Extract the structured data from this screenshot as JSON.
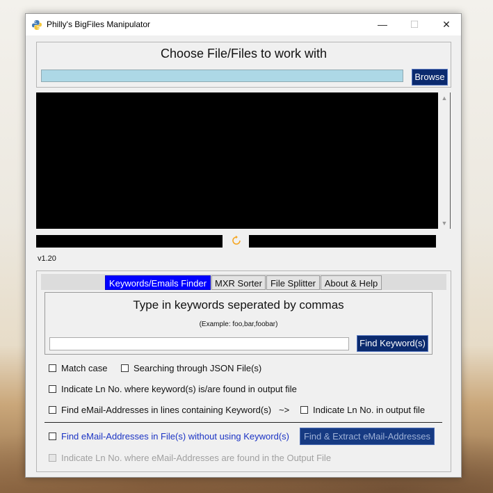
{
  "window": {
    "title": "Philly's BigFiles Manipulator",
    "controls": {
      "minimize": "—",
      "maximize": "☐",
      "close": "✕"
    }
  },
  "choose": {
    "title": "Choose File/Files to work with",
    "path_value": "",
    "browse_label": "Browse"
  },
  "version": "v1.20",
  "tabs": [
    {
      "label": "Keywords/Emails Finder",
      "active": true
    },
    {
      "label": "MXR Sorter",
      "active": false
    },
    {
      "label": "File Splitter",
      "active": false
    },
    {
      "label": "About & Help",
      "active": false
    }
  ],
  "keywords": {
    "title": "Type in keywords seperated by commas",
    "example": "(Example: foo,bar,foobar)",
    "input_value": "",
    "find_label": "Find Keyword(s)"
  },
  "options": {
    "match_case": "Match case",
    "json": "Searching through JSON File(s)",
    "indicate_ln": "Indicate Ln No. where keyword(s) is/are found in output file",
    "find_email_kw": "Find eMail-Addresses in lines containing Keyword(s)",
    "arrow": "~>",
    "indicate_ln_output": "Indicate Ln No. in output file",
    "find_email_no_kw": "Find eMail-Addresses in File(s) without using Keyword(s)",
    "extract_label": "Find & Extract eMail-Addresses",
    "indicate_ln_email": "Indicate Ln No. where eMail-Addresses are found in the Output File"
  },
  "colors": {
    "accent_blue": "#0b2a6e",
    "tab_active": "#0000ff",
    "path_bg": "#add8e6",
    "link_text": "#1b33c4",
    "refresh": "#f5a623"
  },
  "icons": {
    "app": "python-logo-icon",
    "refresh": "refresh-icon"
  }
}
